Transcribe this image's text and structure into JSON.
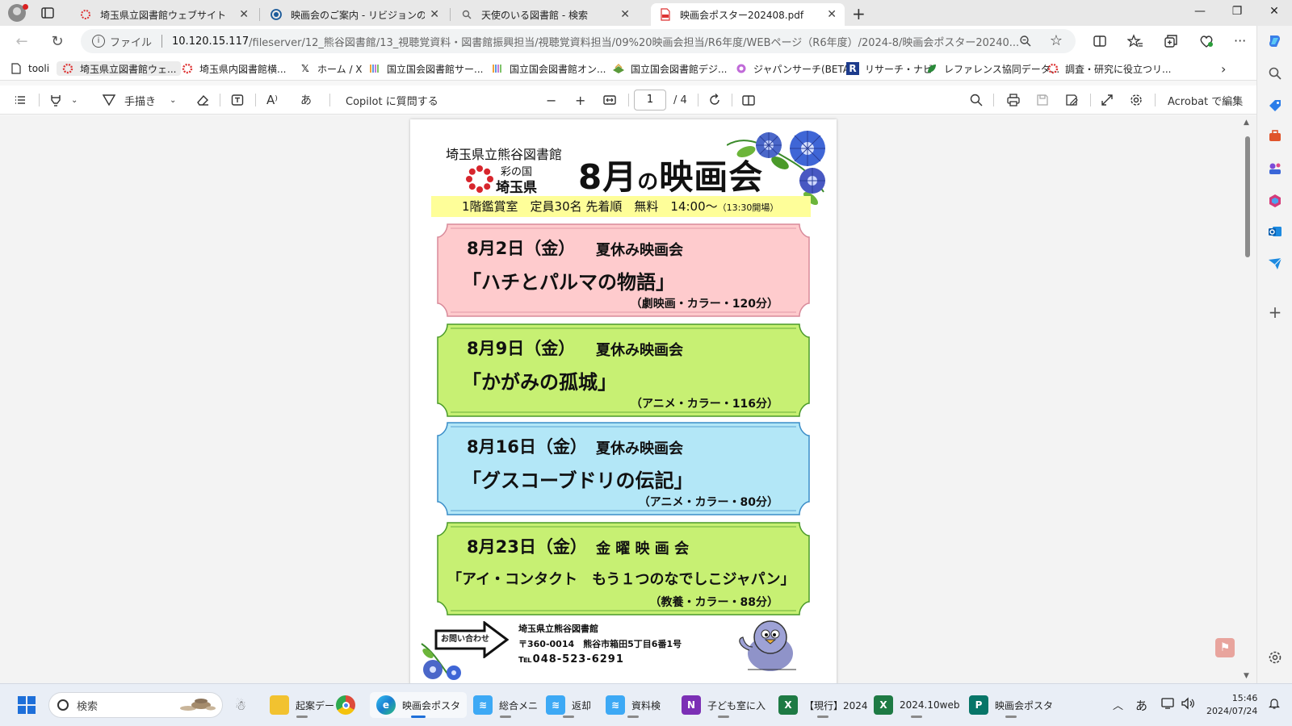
{
  "tabs": [
    {
      "title": "埼玉県立図書館ウェブサイト",
      "icon": "saitama-logo-icon",
      "active": false
    },
    {
      "title": "映画会のご案内 - リビジョンの編集 - ",
      "icon": "wordpress-icon",
      "active": false
    },
    {
      "title": "天使のいる図書館 - 検索",
      "icon": "search-icon",
      "active": false
    },
    {
      "title": "映画会ポスター202408.pdf",
      "icon": "pdf-icon",
      "active": true
    }
  ],
  "address": {
    "scheme": "ファイル",
    "host": "10.120.15.117",
    "path": "/fileserver/12_熊谷図書館/13_視聴覚資料・図書館振興担当/視聴覚資料担当/09%20映画会担当/R6年度/WEBページ（R6年度）/2024-8/映画会ポスター20240..."
  },
  "favorites": [
    {
      "label": "tooli",
      "icon": "page-icon"
    },
    {
      "label": "埼玉県立図書館ウェ...",
      "icon": "saitama-logo-icon"
    },
    {
      "label": "埼玉県内図書館横...",
      "icon": "saitama-logo-icon"
    },
    {
      "label": "ホーム / X",
      "icon": "x-icon"
    },
    {
      "label": "国立国会図書館サー...",
      "icon": "ndl-icon"
    },
    {
      "label": "国立国会図書館オン...",
      "icon": "ndl-icon"
    },
    {
      "label": "国立国会図書館デジ...",
      "icon": "ndl-digital-icon"
    },
    {
      "label": "ジャパンサーチ(BETA)",
      "icon": "japansearch-icon"
    },
    {
      "label": "リサーチ・ナビ",
      "icon": "research-navi-icon"
    },
    {
      "label": "レファレンス協同データ...",
      "icon": "leaf-icon"
    },
    {
      "label": "調査・研究に役立つリ...",
      "icon": "saitama-logo-icon"
    }
  ],
  "pdf_toolbar": {
    "draw_label": "手描き",
    "copilot_label": "Copilot に質問する",
    "page_current": "1",
    "page_total": "/ 4",
    "edit_label": "Acrobat で編集"
  },
  "poster": {
    "library": "埼玉県立熊谷図書館",
    "pref_small": "彩の国",
    "pref": "埼玉県",
    "title_month": "8月",
    "title_no": "の",
    "title_tail": "映画会",
    "info": "1階鑑賞室　定員30名 先着順　無料　14:00～",
    "info_small": "（13:30開場）",
    "screenings": [
      {
        "date": "8月2日（金）",
        "kind": "夏休み映画会",
        "name": "「ハチとパルマの物語」",
        "info": "（劇映画・カラー・120分）",
        "color": "#fecbcd",
        "edge": "#d88a9a"
      },
      {
        "date": "8月9日（金）",
        "kind": "夏休み映画会",
        "name": "「かがみの孤城」",
        "info": "（アニメ・カラー・116分）",
        "color": "#c7f073",
        "edge": "#4a9a2a"
      },
      {
        "date": "8月16日（金）",
        "kind": "夏休み映画会",
        "name": "「グスコーブドリの伝記」",
        "info": "（アニメ・カラー・80分）",
        "color": "#b3e7f7",
        "edge": "#3b8dc8"
      },
      {
        "date": "8月23日（金）",
        "kind": "金 曜 映 画 会",
        "name": "「アイ・コンタクト　もう１つのなでしこジャパン」",
        "info": "（教養・カラー・88分）",
        "color": "#c7f073",
        "edge": "#4a9a2a"
      }
    ],
    "contact_label": "お問い合わせ",
    "contact_name": "埼玉県立熊谷図書館",
    "contact_address": "〒360-0014　熊谷市箱田5丁目6番1号",
    "contact_phone": "℡048-523-6291"
  },
  "taskbar": {
    "search_placeholder": "検索",
    "apps": [
      {
        "label": "起案デー",
        "icon": "folder-icon",
        "color": "#f2c230"
      },
      {
        "label": "",
        "icon": "chrome-icon",
        "color": "#de4a3a"
      },
      {
        "label": "映画会ポスタ",
        "icon": "edge-icon",
        "color": "#1a7fd0"
      },
      {
        "label": "総合メニ",
        "icon": "web-app-icon",
        "color": "#3da9f5"
      },
      {
        "label": "返却",
        "icon": "web-app-icon",
        "color": "#3da9f5"
      },
      {
        "label": "資料検",
        "icon": "web-app-icon",
        "color": "#3da9f5"
      },
      {
        "label": "子ども室に入",
        "icon": "onenote-icon",
        "color": "#7b2fb5"
      },
      {
        "label": "【現行】2024",
        "icon": "excel-icon",
        "color": "#1e7a44"
      },
      {
        "label": "2024.10web",
        "icon": "excel-icon",
        "color": "#1e7a44"
      },
      {
        "label": "映画会ポスタ",
        "icon": "publisher-icon",
        "color": "#077568"
      }
    ],
    "ime": "あ",
    "time": "15:46",
    "date": "2024/07/24"
  }
}
